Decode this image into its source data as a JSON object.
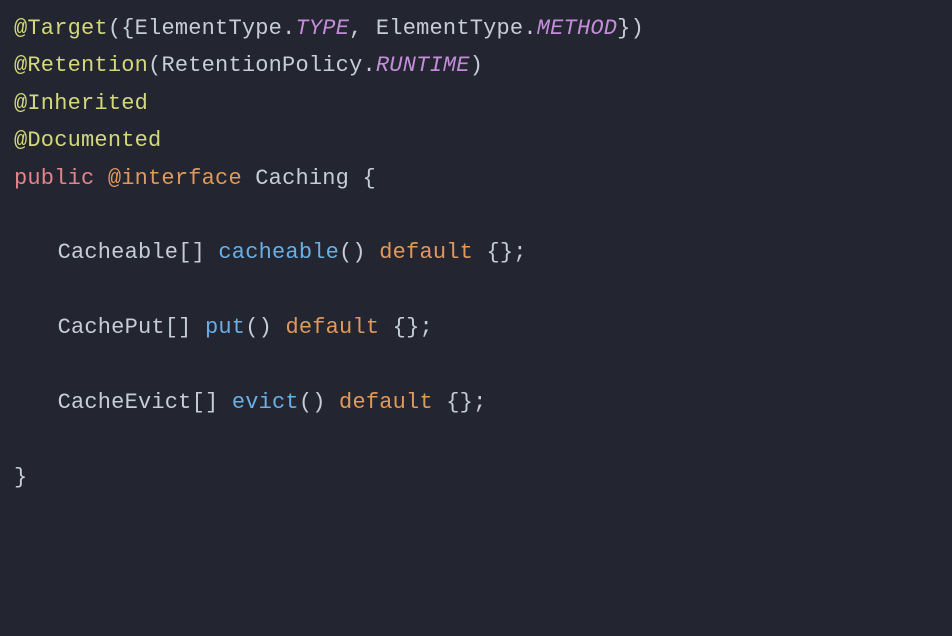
{
  "code": {
    "l1": {
      "annot": "@Target",
      "p1": "({",
      "type1": "ElementType",
      "dot1": ".",
      "const1": "TYPE",
      "comma": ", ",
      "type2": "ElementType",
      "dot2": ".",
      "const2": "METHOD",
      "p2": "})"
    },
    "l2": {
      "annot": "@Retention",
      "p1": "(",
      "type1": "RetentionPolicy",
      "dot1": ".",
      "const1": "RUNTIME",
      "p2": ")"
    },
    "l3": {
      "annot": "@Inherited"
    },
    "l4": {
      "annot": "@Documented"
    },
    "l5": {
      "kw1": "public",
      "sp1": " ",
      "kw2": "@interface",
      "sp2": " ",
      "name": "Caching",
      "sp3": " ",
      "brace": "{"
    },
    "l7": {
      "type": "Cacheable",
      "arr": "[] ",
      "method": "cacheable",
      "p1": "() ",
      "kw": "default",
      "p2": " {};"
    },
    "l9": {
      "type": "CachePut",
      "arr": "[] ",
      "method": "put",
      "p1": "() ",
      "kw": "default",
      "p2": " {};"
    },
    "l11": {
      "type": "CacheEvict",
      "arr": "[] ",
      "method": "evict",
      "p1": "() ",
      "kw": "default",
      "p2": " {};"
    },
    "l13": {
      "brace": "}"
    }
  }
}
